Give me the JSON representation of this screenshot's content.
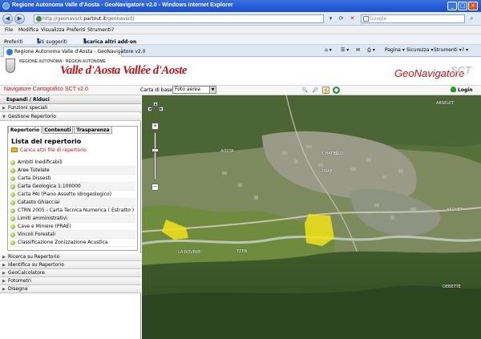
{
  "browser": {
    "window_title": "Regione Autonoma Valle d'Aosta - GeoNavigatore v2.0 - Windows Internet Explorer",
    "address_prefix": "http://geonavsct.",
    "address_host": "partout.it",
    "address_suffix": "/geonavsct/",
    "search_placeholder": "Google",
    "menu": [
      "File",
      "Modifica",
      "Visualizza",
      "Preferiti",
      "Strumenti",
      "?"
    ],
    "favorites": {
      "label": "Preferiti",
      "suggested": "Siti suggeriti",
      "addons": "Scarica altri add-on"
    },
    "tab_title": "Regione Autonoma Valle d'Aosta - GeoNavigatore v2.0",
    "tools": [
      "Pagina",
      "Sicurezza",
      "Strumenti"
    ]
  },
  "header": {
    "region_small": "REGIONE AUTONOMA · RÉGION AUTONOME",
    "region_big": "Valle d'Aosta Vallée d'Aoste",
    "brand": "GeoNavigatore",
    "brand_mark": "SCT"
  },
  "toolbar": {
    "app_title": "Navigatore Cartografico SCT v2.0",
    "basemap_label": "Carta di base",
    "basemap_value": "Foto aerea",
    "login": "Login"
  },
  "panel": {
    "header": "Espandi / Riduci",
    "sections_top": [
      "Funzioni speciali",
      "Gestione Repertorio"
    ],
    "tabs": [
      "Repertorio",
      "Contenuti",
      "Trasparenza"
    ],
    "list_title": "Lista del repertorio",
    "load_link": "Carica altri file di repertorio",
    "layers": [
      "Ambiti Inedificabili",
      "Aree Tutelate",
      "Carta Dissesti",
      "Carta Geologica 1:100000",
      "Carta PAI (Piano Assetto Idrogeologico)",
      "Catasto Ghiacciai",
      "CTRN 2005 - Carta Tecnica Numerica ( Estratto )",
      "Limiti amministrativi",
      "Cave e Miniere (PRAE)",
      "Vincoli Forestali",
      "Classificazione Zonizzazione Acustica"
    ],
    "sections_bottom": [
      "Ricerca su Repertorio",
      "Identifica su Repertorio",
      "GeoCalcolatore",
      "Fotometri",
      "Disegna"
    ]
  },
  "map": {
    "labels": [
      "ARSELET",
      "AOSTA",
      "CHATELLO",
      "PRAE",
      "LA ROVERE",
      "TZEN",
      "ARCHET",
      "DEBETTE"
    ]
  },
  "colors": {
    "brand_red": "#c0151b",
    "titlebar_blue": "#245edb",
    "highlight_yellow": "#f2e21a"
  }
}
